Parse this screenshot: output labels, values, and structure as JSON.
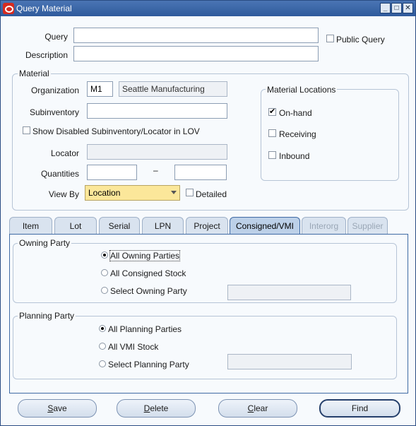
{
  "window": {
    "title": "Query Material"
  },
  "query": {
    "query_label": "Query",
    "query_value": "",
    "public_query_label": "Public Query",
    "public_query_checked": false,
    "description_label": "Description",
    "description_value": ""
  },
  "material": {
    "group_title": "Material",
    "organization_label": "Organization",
    "organization_code": "M1",
    "organization_name": "Seattle Manufacturing",
    "subinventory_label": "Subinventory",
    "subinventory_value": "",
    "show_disabled_label": "Show Disabled Subinventory/Locator in LOV",
    "show_disabled_checked": false,
    "locator_label": "Locator",
    "locator_value": "",
    "quantities_label": "Quantities",
    "quantities_from": "",
    "quantities_separator": "–",
    "quantities_to": "",
    "view_by_label": "View By",
    "view_by_value": "Location",
    "detailed_label": "Detailed",
    "detailed_checked": false
  },
  "material_locations": {
    "group_title": "Material Locations",
    "items": [
      {
        "label": "On-hand",
        "checked": true
      },
      {
        "label": "Receiving",
        "checked": false
      },
      {
        "label": "Inbound",
        "checked": false
      }
    ]
  },
  "tabs": [
    {
      "label": "Item",
      "state": "normal"
    },
    {
      "label": "Lot",
      "state": "normal"
    },
    {
      "label": "Serial",
      "state": "normal"
    },
    {
      "label": "LPN",
      "state": "normal"
    },
    {
      "label": "Project",
      "state": "normal"
    },
    {
      "label": "Consigned/VMI",
      "state": "active"
    },
    {
      "label": "Interorg",
      "state": "disabled"
    },
    {
      "label": "Supplier",
      "state": "disabled"
    }
  ],
  "owning_party": {
    "group_title": "Owning Party",
    "options": [
      {
        "label": "All Owning Parties",
        "selected": true
      },
      {
        "label": "All Consigned Stock",
        "selected": false
      },
      {
        "label": "Select Owning Party",
        "selected": false
      }
    ],
    "select_value": ""
  },
  "planning_party": {
    "group_title": "Planning Party",
    "options": [
      {
        "label": "All Planning Parties",
        "selected": true
      },
      {
        "label": "All VMI Stock",
        "selected": false
      },
      {
        "label": "Select Planning Party",
        "selected": false
      }
    ],
    "select_value": ""
  },
  "buttons": {
    "save_mnemonic": "S",
    "save_rest": "ave",
    "delete_mnemonic": "D",
    "delete_rest": "elete",
    "clear_mnemonic": "C",
    "clear_rest": "lear",
    "find": "Find"
  },
  "colors": {
    "title_bar": "#2f5a9c",
    "active_tab": "#bcd0e8",
    "view_by_field": "#fbe79a"
  }
}
